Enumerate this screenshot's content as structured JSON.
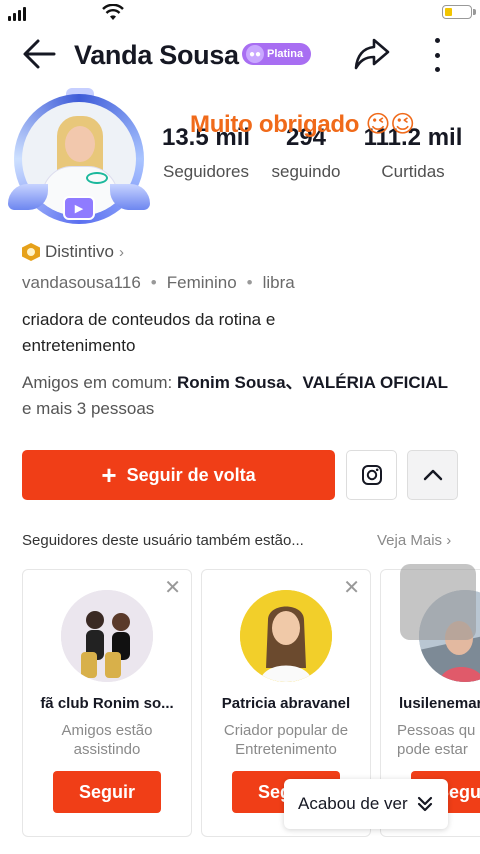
{
  "header": {
    "title": "Vanda Sousa",
    "badge": "Platina",
    "back_icon": "arrow-left-icon",
    "share_icon": "share-arrow-icon",
    "more_icon": "more-vertical-icon"
  },
  "overlay": "Muito obrigado 😉😉",
  "stats": [
    {
      "value": "13.5 mil",
      "label": "Seguidores"
    },
    {
      "value": "294",
      "label": "seguindo"
    },
    {
      "value": "111.2 mil",
      "label": "Curtidas"
    }
  ],
  "profile": {
    "distintivo": "Distintivo",
    "username": "vandasousa116",
    "gender": "Feminino",
    "sign": "libra",
    "bio": "criadora de conteudos da rotina e entretenimento",
    "mutual_prefix": "Amigos em comum: ",
    "mutual_names": "Ronim Sousa、VALÉRIA OFICIAL",
    "mutual_suffix": " e mais 3 pessoas"
  },
  "actions": {
    "follow_back": "Seguir de volta",
    "instagram_icon": "instagram-icon",
    "collapse_icon": "chevron-up-icon"
  },
  "suggestions": {
    "title": "Seguidores deste usuário também estão...",
    "see_more": "Veja Mais",
    "cards": [
      {
        "name": "fã club Ronim so...",
        "desc": "Amigos estão assistindo",
        "button": "Seguir"
      },
      {
        "name": "Patricia abravanel",
        "desc": "Criador popular de Entretenimento",
        "button": "Seguir"
      },
      {
        "name": "lusilenemar",
        "desc": "Pessoas qu pode estar",
        "button": "Seguir"
      }
    ]
  },
  "finished_watching": "Acabou de ver",
  "colors": {
    "accent": "#f03e17",
    "badge": "#a86ef2",
    "overlay": "#f06a1a"
  }
}
